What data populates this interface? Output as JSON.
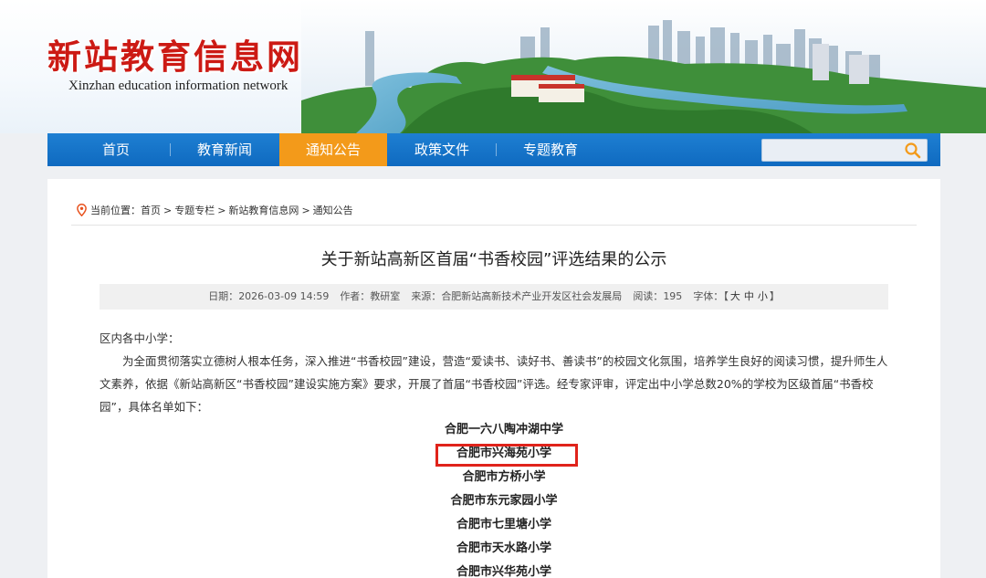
{
  "header": {
    "title": "新站教育信息网",
    "subtitle": "Xinzhan education information network"
  },
  "nav": {
    "items": [
      {
        "label": "首页"
      },
      {
        "label": "教育新闻"
      },
      {
        "label": "通知公告",
        "active": true
      },
      {
        "label": "政策文件"
      },
      {
        "label": "专题教育"
      }
    ],
    "search_placeholder": "",
    "accent_color": "#f39a1a",
    "bar_color": "#1270c6"
  },
  "breadcrumb": {
    "prefix": "当前位置：",
    "items": [
      "首页",
      "专题专栏",
      "新站教育信息网",
      "通知公告"
    ],
    "separator": ">"
  },
  "article": {
    "title": "关于新站高新区首届“书香校园”评选结果的公示",
    "meta": {
      "date_label": "日期：",
      "date": "2026-03-09 14:59",
      "author_label": "作者：",
      "author": "教研室",
      "source_label": "来源：",
      "source": "合肥新站高新技术产业开发区社会发展局",
      "views_label": "阅读：",
      "views": "195",
      "font_label": "字体：",
      "font_open": "【",
      "font_large": "大",
      "font_medium": "中",
      "font_small": "小",
      "font_close": "】"
    },
    "greeting": "区内各中小学：",
    "paragraph": "为全面贯彻落实立德树人根本任务，深入推进“书香校园”建设，营造“爱读书、读好书、善读书”的校园文化氛围，培养学生良好的阅读习惯，提升师生人文素养，依据《新站高新区“书香校园”建设实施方案》要求，开展了首届“书香校园”评选。经专家评审，评定出中小学总数20%的学校为区级首届“书香校园”，具体名单如下：",
    "schools": [
      "合肥一六八陶冲湖中学",
      "合肥市兴海苑小学",
      "合肥市方桥小学",
      "合肥市东元家园小学",
      "合肥市七里塘小学",
      "合肥市天水路小学",
      "合肥市兴华苑小学"
    ],
    "highlight_color": "#e0231b"
  }
}
